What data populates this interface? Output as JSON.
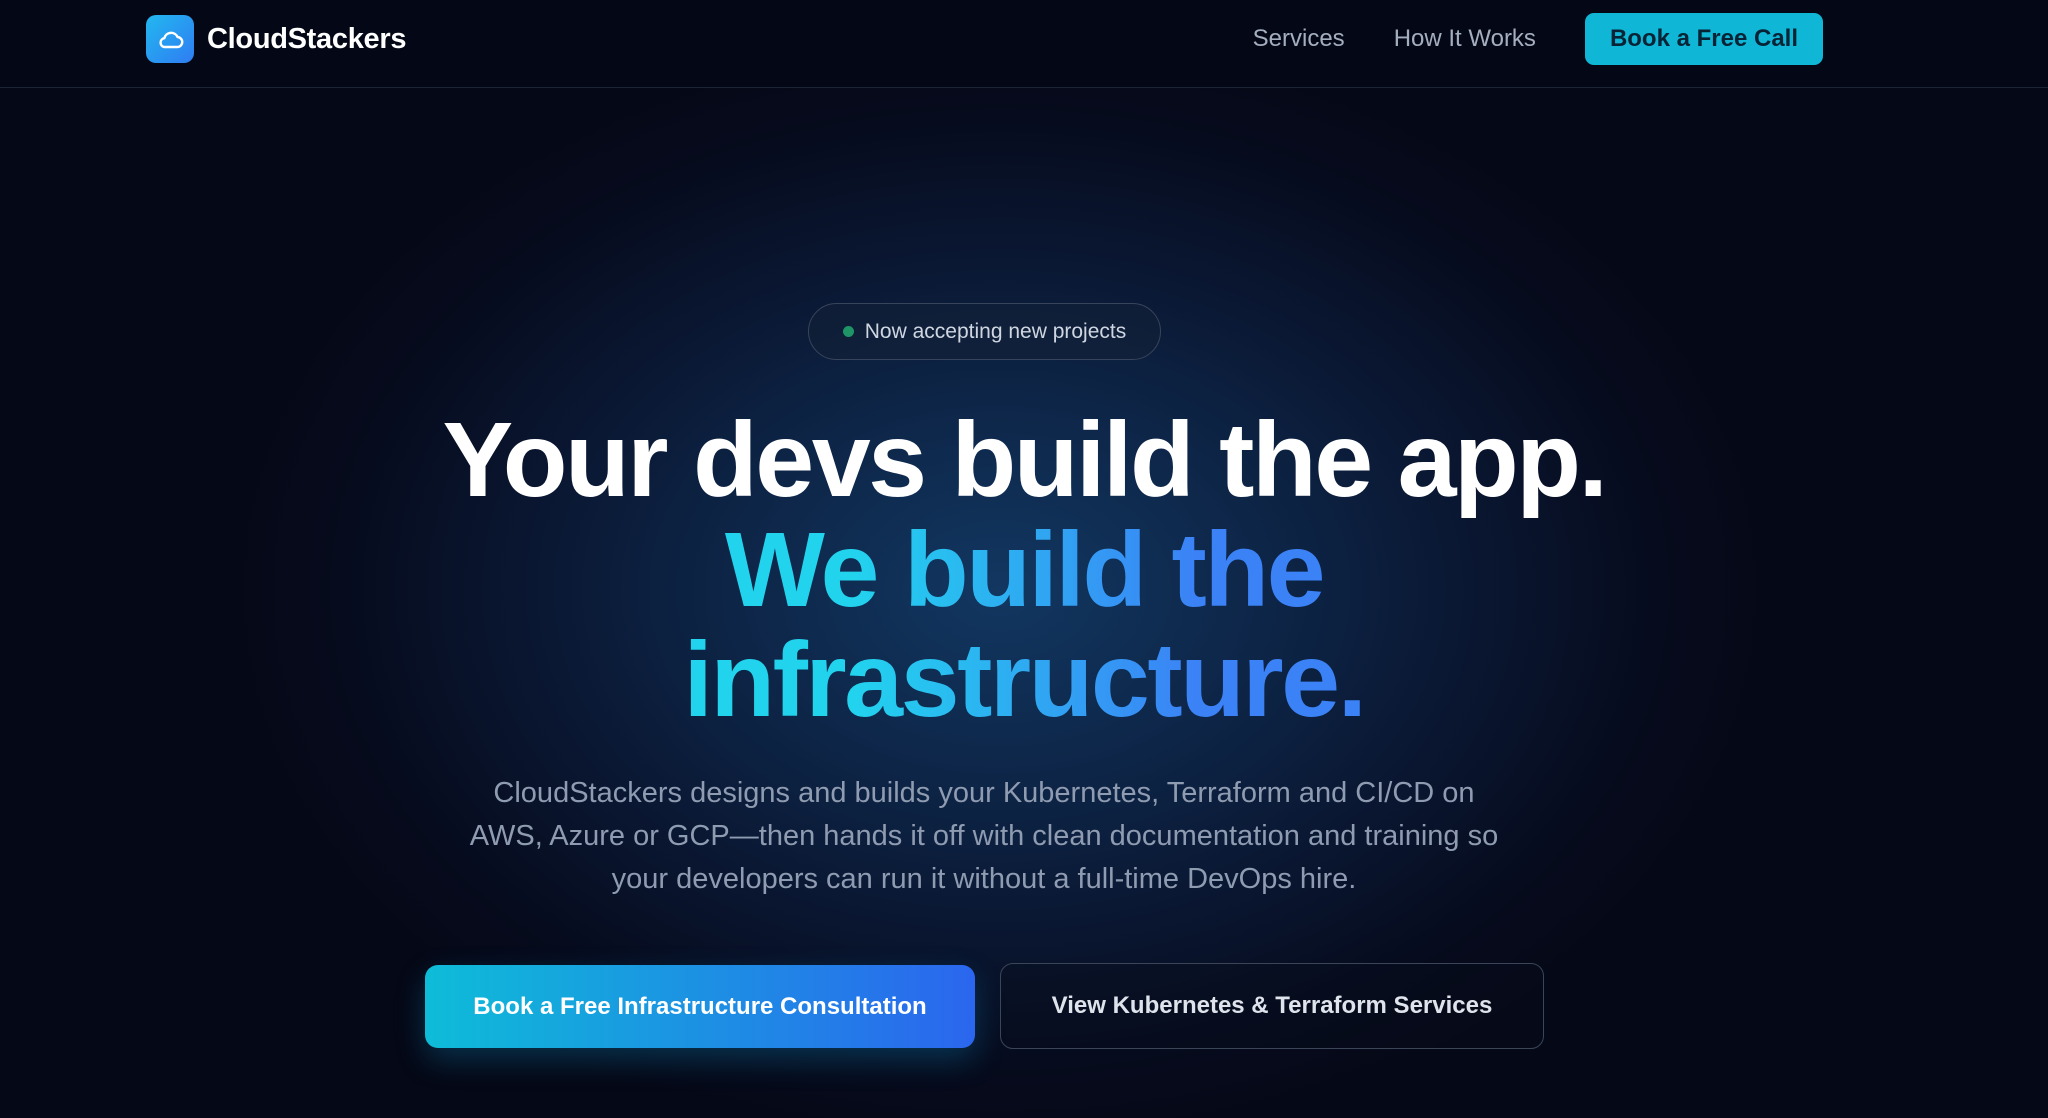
{
  "nav": {
    "brand": "CloudStackers",
    "links": [
      "Services",
      "How It Works"
    ],
    "cta_label": "Book a Free Call"
  },
  "hero": {
    "badge": "Now accepting new projects",
    "headline_line1": "Your devs build the app.",
    "headline_line2": "We build the infrastructure.",
    "subtext": "CloudStackers designs and builds your Kubernetes, Terraform and CI/CD on AWS, Azure or GCP—then hands it off with clean documentation and training so your developers can run it without a full-time DevOps hire.",
    "primary_cta": "Book a Free Infrastructure Consultation",
    "secondary_cta": "View Kubernetes & Terraform Services"
  },
  "colors": {
    "background": "#050816",
    "accent_cyan": "#22d3ee",
    "accent_blue": "#3b82f6",
    "nav_cta": "#0fb6d6",
    "status_dot": "#1f9466"
  },
  "icons": {
    "logo": "cloud-icon"
  }
}
